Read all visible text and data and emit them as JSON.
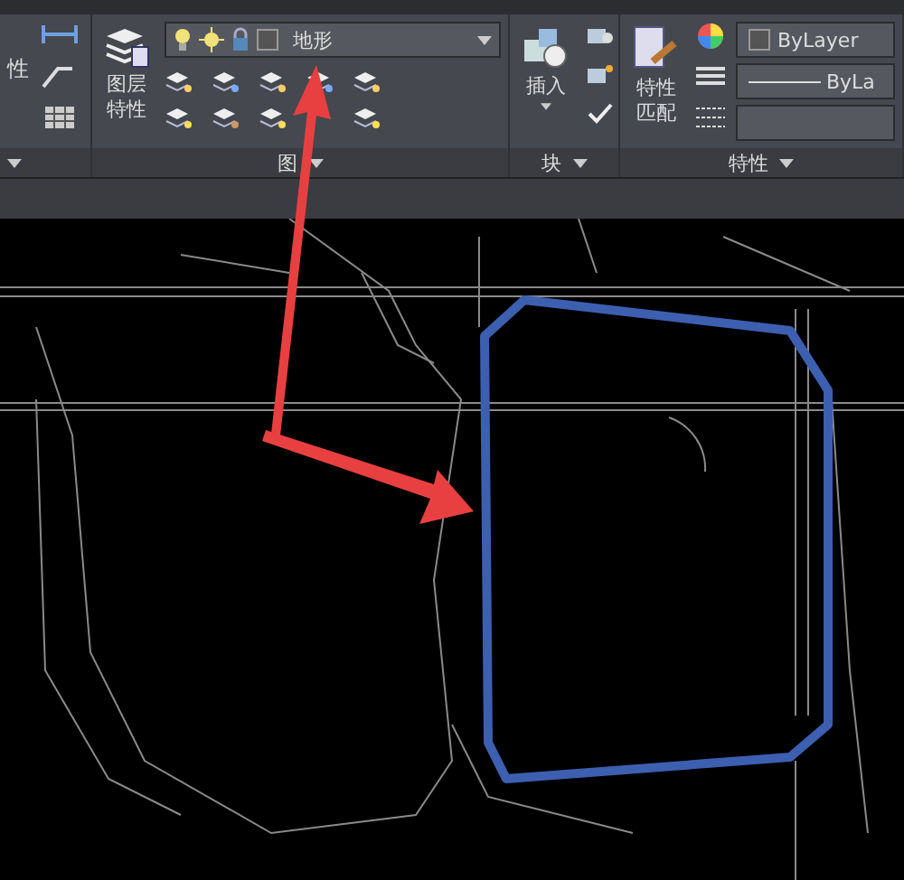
{
  "left_panel": {
    "label": "性"
  },
  "layers_panel": {
    "title": "图",
    "button": "图层特性",
    "current_layer": "地形"
  },
  "block_panel": {
    "title": "块",
    "button": "插入"
  },
  "properties_panel": {
    "title": "特性",
    "button": "特性匹配",
    "color_setting": "ByLayer",
    "linetype": "ByLa"
  }
}
